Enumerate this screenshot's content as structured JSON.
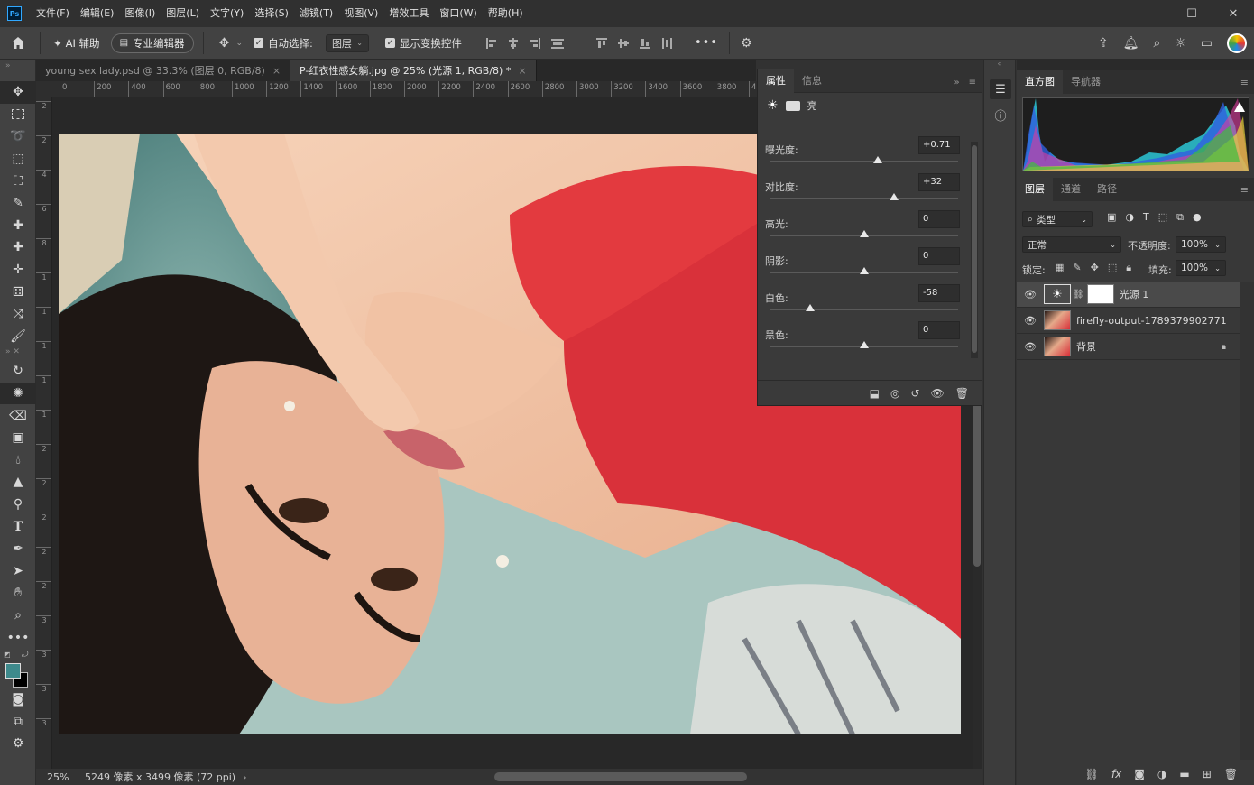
{
  "app": {
    "logo": "Ps"
  },
  "menu": [
    "文件(F)",
    "编辑(E)",
    "图像(I)",
    "图层(L)",
    "文字(Y)",
    "选择(S)",
    "滤镜(T)",
    "视图(V)",
    "增效工具",
    "窗口(W)",
    "帮助(H)"
  ],
  "window_controls": {
    "minimize": "—",
    "maximize": "☐",
    "close": "✕"
  },
  "options": {
    "ai_assist": "AI 辅助",
    "pro_editor": "专业编辑器",
    "auto_select_label": "自动选择:",
    "auto_select_value": "图层",
    "show_transform": "显示变换控件",
    "more": "•••"
  },
  "tabs": [
    {
      "label": "young sex lady.psd @ 33.3% (图层 0, RGB/8)",
      "close": "×"
    },
    {
      "label": "P-红衣性感女躺.jpg @ 25% (光源 1, RGB/8) *",
      "close": "×"
    }
  ],
  "ruler_h": [
    "0",
    "200",
    "400",
    "600",
    "800",
    "1000",
    "1200",
    "1400",
    "1600",
    "1800",
    "2000",
    "2200",
    "2400",
    "2600",
    "2800",
    "3000",
    "3200",
    "3400",
    "3600",
    "3800",
    "4"
  ],
  "ruler_v": [
    "2",
    "2",
    "4",
    "6",
    "8",
    "1",
    "1",
    "1",
    "1",
    "1",
    "2",
    "2",
    "2",
    "2",
    "2",
    "3",
    "3",
    "3",
    "3"
  ],
  "status": {
    "zoom": "25%",
    "doc_info": "5249 像素 x 3499 像素 (72 ppi)",
    "arrow": "›"
  },
  "properties": {
    "tabs": [
      "属性",
      "信息"
    ],
    "type_label": "亮",
    "sliders": [
      {
        "label": "曝光度:",
        "value": "+0.71",
        "pos": 0.57
      },
      {
        "label": "对比度:",
        "value": "+32",
        "pos": 0.66
      },
      {
        "label": "高光:",
        "value": "0",
        "pos": 0.5
      },
      {
        "label": "阴影:",
        "value": "0",
        "pos": 0.5
      },
      {
        "label": "白色:",
        "value": "-58",
        "pos": 0.21
      },
      {
        "label": "黑色:",
        "value": "0",
        "pos": 0.5
      }
    ]
  },
  "histogram_panel": {
    "tabs": [
      "直方图",
      "导航器"
    ]
  },
  "layers_panel": {
    "tabs": [
      "图层",
      "通道",
      "路径"
    ],
    "filter_kind": "类型",
    "blend_mode": "正常",
    "opacity_label": "不透明度:",
    "opacity_value": "100%",
    "lock_label": "锁定:",
    "fill_label": "填充:",
    "fill_value": "100%",
    "layers": [
      {
        "name": "光源 1",
        "selected": true
      },
      {
        "name": "firefly-output-1789379902771",
        "selected": false
      },
      {
        "name": "背景",
        "selected": false
      }
    ]
  },
  "colors": {
    "accent": "#31a8ff",
    "foreground": "#3e8a8c",
    "background": "#000000",
    "dress": "#d8323a"
  }
}
